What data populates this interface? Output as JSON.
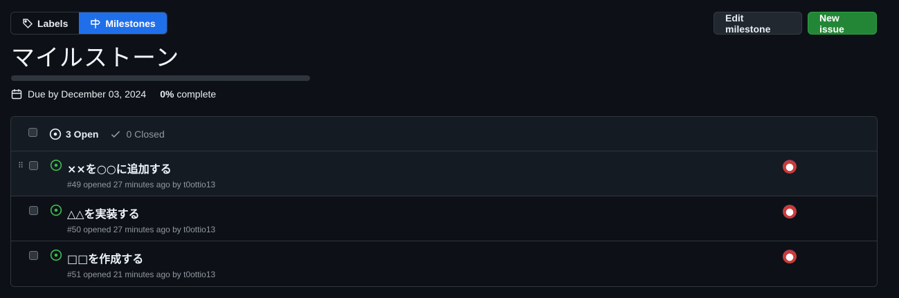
{
  "nav": {
    "labels": "Labels",
    "milestones": "Milestones"
  },
  "actions": {
    "edit": "Edit milestone",
    "new_issue": "New issue"
  },
  "milestone": {
    "title": "マイルストーン",
    "due": "Due by December 03, 2024",
    "percent": "0%",
    "complete_label": "complete",
    "progress": 0
  },
  "list": {
    "open_label": "3 Open",
    "closed_label": "0 Closed",
    "issues": [
      {
        "title": "××を○○に追加する",
        "meta": "#49 opened 27 minutes ago by t0ottio13"
      },
      {
        "title": "△△を実装する",
        "meta": "#50 opened 27 minutes ago by t0ottio13"
      },
      {
        "title": "□□を作成する",
        "meta": "#51 opened 21 minutes ago by t0ottio13"
      }
    ]
  },
  "colors": {
    "accent": "#1f6feb",
    "primary": "#238636",
    "open": "#3fb950"
  }
}
